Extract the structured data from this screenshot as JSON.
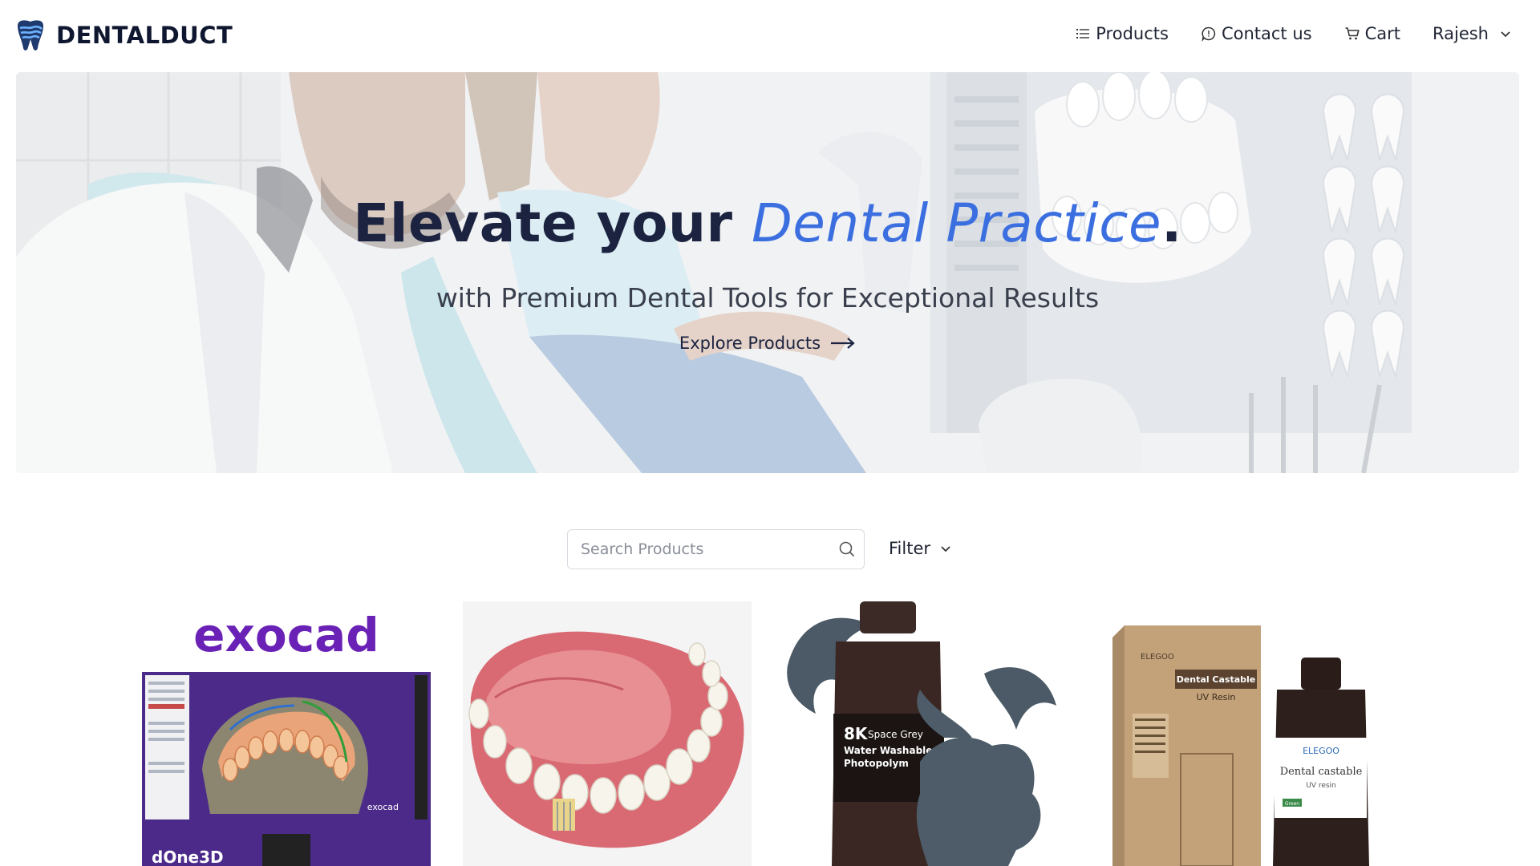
{
  "header": {
    "brand": "DENTALDUCT",
    "nav": {
      "products": "Products",
      "contact": "Contact us",
      "cart": "Cart",
      "user": "Rajesh"
    }
  },
  "hero": {
    "title_part1": "Elevate your ",
    "title_accent": "Dental Practice",
    "title_end": ".",
    "subtitle": "with Premium Dental Tools for Exceptional Results",
    "cta": "Explore Products"
  },
  "search": {
    "placeholder": "Search Products",
    "value": ""
  },
  "filter": {
    "label": "Filter"
  },
  "products": [
    {
      "brand_text": "exocad",
      "screen_text": "exocad",
      "footer_text": "dOne3D"
    },
    {
      "brand_text": ""
    },
    {
      "badge_big": "8K",
      "badge_line1": "Space Grey",
      "badge_line2": "Water Washable",
      "badge_line3": "Photopolym"
    },
    {
      "box_brand": "ELEGOO",
      "box_title": "Dental Castable",
      "box_sub": "UV Resin",
      "bottle_brand": "ELEGOO",
      "bottle_title": "Dental castable",
      "bottle_sub": "UV resin",
      "bottle_tag": "Green"
    }
  ],
  "colors": {
    "accent": "#3b6fe0",
    "title": "#1b2340",
    "exocad_purple": "#6a21b5"
  }
}
